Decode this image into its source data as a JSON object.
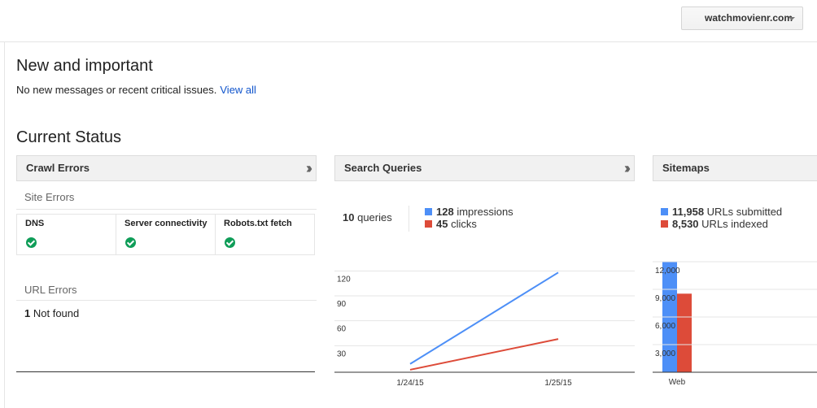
{
  "header": {
    "site": "watchmovienr.com"
  },
  "new_important": {
    "title": "New and important",
    "message": "No new messages or recent critical issues.",
    "link": "View all"
  },
  "current_status": {
    "title": "Current Status"
  },
  "crawl_errors": {
    "title": "Crawl Errors",
    "site_errors_label": "Site Errors",
    "site_errors": [
      {
        "label": "DNS",
        "status": "ok"
      },
      {
        "label": "Server connectivity",
        "status": "ok"
      },
      {
        "label": "Robots.txt fetch",
        "status": "ok"
      }
    ],
    "url_errors_label": "URL Errors",
    "url_errors": {
      "count": "1",
      "label": "Not found"
    }
  },
  "search_queries": {
    "title": "Search Queries",
    "queries": {
      "count": "10",
      "label": "queries"
    },
    "impressions": {
      "count": "128",
      "label": "impressions",
      "color": "#4d8ff7"
    },
    "clicks": {
      "count": "45",
      "label": "clicks",
      "color": "#dd4b39"
    }
  },
  "sitemaps": {
    "title": "Sitemaps",
    "submitted": {
      "count": "11,958",
      "label": "URLs submitted",
      "color": "#4d8ff7"
    },
    "indexed": {
      "count": "8,530",
      "label": "URLs indexed",
      "color": "#dd4b39"
    }
  },
  "chart_data": [
    {
      "type": "line",
      "x": [
        "1/24/15",
        "1/25/15"
      ],
      "series": [
        {
          "name": "impressions",
          "values": [
            10,
            120
          ],
          "color": "#4d8ff7"
        },
        {
          "name": "clicks",
          "values": [
            3,
            40
          ],
          "color": "#dd4b39"
        }
      ],
      "yticks": [
        "120",
        "90",
        "60",
        "30"
      ],
      "ylim": [
        0,
        135
      ]
    },
    {
      "type": "bar",
      "categories": [
        "Web"
      ],
      "series": [
        {
          "name": "URLs submitted",
          "values": [
            11958
          ],
          "color": "#4d8ff7"
        },
        {
          "name": "URLs indexed",
          "values": [
            8530
          ],
          "color": "#dd4b39"
        }
      ],
      "yticks": [
        "12,000",
        "9,000",
        "6,000",
        "3,000"
      ],
      "ylim": [
        0,
        12000
      ]
    }
  ]
}
